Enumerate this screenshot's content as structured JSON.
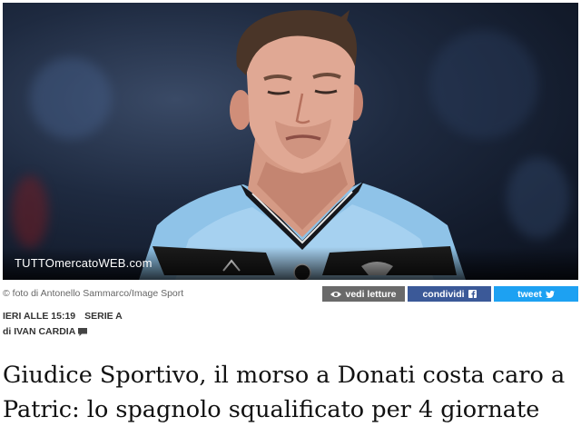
{
  "photo": {
    "watermark": "TUTTOmercatoWEB.com",
    "credit": "© foto di Antonello Sammarco/Image Sport"
  },
  "share": {
    "read_label": "vedi letture",
    "share_label": "condividi",
    "tweet_label": "tweet"
  },
  "meta": {
    "date": "IERI ALLE 15:19",
    "category": "SERIE A",
    "author": "di IVAN CARDIA"
  },
  "article": {
    "title": "Giudice Sportivo, il morso a Donati costa caro a Patric: lo spagnolo squalificato per 4 giornate"
  },
  "colors": {
    "read_button": "#6a6a6a",
    "facebook": "#3b5998",
    "twitter": "#1da1f2"
  }
}
